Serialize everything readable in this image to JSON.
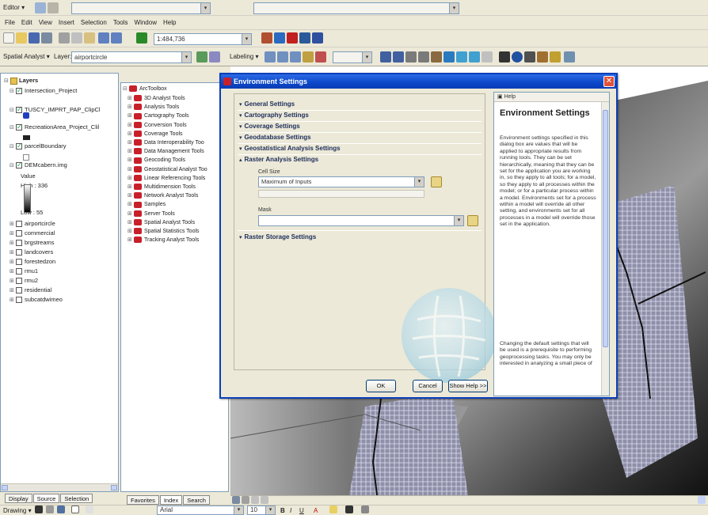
{
  "toolbar1": {
    "editor_label": "Editor ▾",
    "task_dropdown": "",
    "target_dropdown": ""
  },
  "menubar": {
    "items": [
      "File",
      "Edit",
      "View",
      "Insert",
      "Selection",
      "Tools",
      "Window",
      "Help"
    ]
  },
  "toolbar3": {
    "scale_value": "1:484,736"
  },
  "toolbar4": {
    "spatial_analyst_label": "Spatial Analyst ▾",
    "layer_label": "Layer:",
    "layer_value": "airportcircle",
    "labeling_label": "Labeling ▾"
  },
  "toc": {
    "root": "Layers",
    "items": [
      {
        "label": "Intersection_Project",
        "checked": true,
        "indent": 1
      },
      {
        "label": "TUSCY_IMPRT_PAP_ClipCl",
        "checked": true,
        "indent": 1
      },
      {
        "label": "RecreationArea_Project_Clil",
        "checked": true,
        "indent": 1
      },
      {
        "label": "parcelBoundary",
        "checked": true,
        "indent": 1
      },
      {
        "label": "DEMcabern.img",
        "checked": true,
        "indent": 1
      },
      {
        "label": "Value",
        "checked": null,
        "indent": 3
      },
      {
        "label": "High : 336",
        "checked": null,
        "indent": 3
      },
      {
        "label": "Low : 55",
        "checked": null,
        "indent": 3
      },
      {
        "label": "airportcircle",
        "checked": false,
        "indent": 1
      },
      {
        "label": "commercial",
        "checked": false,
        "indent": 1
      },
      {
        "label": "brgstreams",
        "checked": false,
        "indent": 1
      },
      {
        "label": "landcovers",
        "checked": false,
        "indent": 1
      },
      {
        "label": "forestedzon",
        "checked": false,
        "indent": 1
      },
      {
        "label": "rmu1",
        "checked": false,
        "indent": 1
      },
      {
        "label": "rmu2",
        "checked": false,
        "indent": 1
      },
      {
        "label": "residential",
        "checked": false,
        "indent": 1
      },
      {
        "label": "subcatdwimeo",
        "checked": false,
        "indent": 1
      }
    ],
    "tabs": [
      "Display",
      "Source",
      "Selection"
    ]
  },
  "arctoolbox": {
    "root": "ArcToolbox",
    "items": [
      "3D Analyst Tools",
      "Analysis Tools",
      "Cartography Tools",
      "Conversion Tools",
      "Coverage Tools",
      "Data Interoperability Too",
      "Data Management Tools",
      "Geocoding Tools",
      "Geostatistical Analyst Too",
      "Linear Referencing Tools",
      "Multidimension Tools",
      "Network Analyst Tools",
      "Samples",
      "Server Tools",
      "Spatial Analyst Tools",
      "Spatial Statistics Tools",
      "Tracking Analyst Tools"
    ],
    "tabs": [
      "Favorites",
      "Index",
      "Search"
    ]
  },
  "dialog": {
    "title": "Environment Settings",
    "sections": [
      "General Settings",
      "Cartography Settings",
      "Coverage Settings",
      "Geodatabase Settings",
      "Geostatistical Analysis Settings",
      "Raster Analysis Settings",
      "Raster Storage Settings"
    ],
    "cell_size_label": "Cell Size",
    "cell_size_value": "Maximum of Inputs",
    "mask_label": "Mask",
    "mask_value": "",
    "ok_label": "OK",
    "cancel_label": "Cancel",
    "show_help_label": "Show Help >>",
    "help_pane_label": "Help",
    "help_title": "Environment Settings",
    "help_paragraphs": [
      "Environment settings specified in this dialog box are values that will be applied to appropriate results from running tools. They can be set hierarchically, meaning that they can be set for the application you are working in, so they apply to all tools; for a model, so they apply to all processes within the model; or for a particular process within a model. Environments set for a process within a model will override all other setting, and environments set for all processes in a model will override those set in the application.",
      "Changing the default settings that will be used is a prerequisite to performing geoprocessing tasks. You may only be interested in analyzing a small piece of"
    ]
  },
  "drawing": {
    "drawing_label": "Drawing ▾",
    "font_value": "Arial",
    "size_value": "10"
  },
  "colors": {
    "titlebar": "#0b47c8",
    "section_text": "#1c2d5a",
    "toolbox_red": "#c8202a"
  }
}
